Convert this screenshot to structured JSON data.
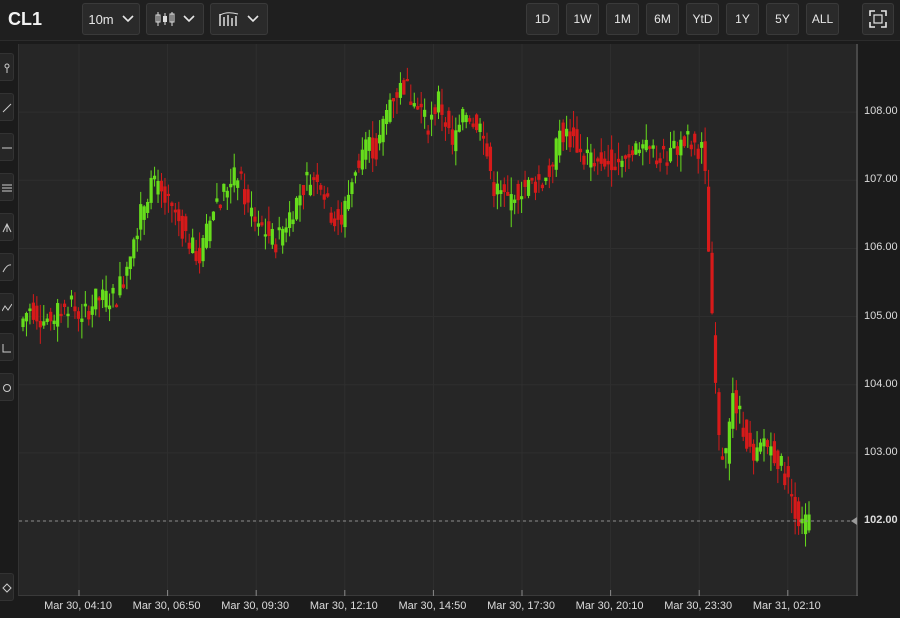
{
  "toolbar": {
    "ticker": "CL1",
    "interval": "10m",
    "chart_style_icon": "candlestick-icon",
    "indicators_icon": "indicators-icon",
    "ranges": [
      "1D",
      "1W",
      "1M",
      "6M",
      "YtD",
      "1Y",
      "5Y",
      "ALL"
    ],
    "fullscreen_icon": "fullscreen-icon"
  },
  "sidebar_tools": [
    "pin-icon",
    "trendline-icon",
    "horizontal-line-icon",
    "fibonacci-icon",
    "pitchfork-icon",
    "brush-icon",
    "pattern-icon",
    "measure-icon",
    "shapes-icon"
  ],
  "colors": {
    "up": "#66dd1c",
    "down": "#d61a1a",
    "background": "#262626"
  },
  "chart_data": {
    "type": "candlestick",
    "symbol": "CL1",
    "interval": "10m",
    "x_tick_labels": [
      "Mar 30, 04:10",
      "Mar 30, 06:50",
      "Mar 30, 09:30",
      "Mar 30, 12:10",
      "Mar 30, 14:50",
      "Mar 30, 17:30",
      "Mar 30, 20:10",
      "Mar 30, 23:30",
      "Mar 31, 02:10"
    ],
    "y_tick_labels": [
      "102.00",
      "103.00",
      "104.00",
      "105.00",
      "106.00",
      "107.00",
      "108.00"
    ],
    "ylim": [
      100.9,
      109.0
    ],
    "last_price": 102.0,
    "grid": true,
    "path_points": [
      [
        0,
        104.85
      ],
      [
        3,
        105.15
      ],
      [
        8,
        104.9
      ],
      [
        14,
        105.2
      ],
      [
        18,
        105.0
      ],
      [
        22,
        105.25
      ],
      [
        28,
        105.3
      ],
      [
        32,
        106.0
      ],
      [
        35,
        106.5
      ],
      [
        38,
        107.0
      ],
      [
        42,
        106.7
      ],
      [
        46,
        106.4
      ],
      [
        50,
        106.0
      ],
      [
        52,
        105.85
      ],
      [
        56,
        106.6
      ],
      [
        60,
        106.9
      ],
      [
        63,
        107.1
      ],
      [
        66,
        106.6
      ],
      [
        70,
        106.3
      ],
      [
        74,
        106.1
      ],
      [
        78,
        106.5
      ],
      [
        82,
        106.9
      ],
      [
        86,
        107.1
      ],
      [
        90,
        106.5
      ],
      [
        93,
        106.4
      ],
      [
        97,
        107.2
      ],
      [
        100,
        107.6
      ],
      [
        103,
        107.4
      ],
      [
        107,
        108.2
      ],
      [
        111,
        108.4
      ],
      [
        115,
        108.1
      ],
      [
        118,
        107.8
      ],
      [
        121,
        108.2
      ],
      [
        125,
        107.5
      ],
      [
        129,
        108.0
      ],
      [
        133,
        107.8
      ],
      [
        137,
        106.9
      ],
      [
        141,
        106.7
      ],
      [
        145,
        106.9
      ],
      [
        149,
        106.95
      ],
      [
        153,
        107.1
      ],
      [
        156,
        107.7
      ],
      [
        160,
        107.6
      ],
      [
        163,
        107.35
      ],
      [
        166,
        107.25
      ],
      [
        170,
        107.3
      ],
      [
        174,
        107.35
      ],
      [
        178,
        107.5
      ],
      [
        182,
        107.4
      ],
      [
        186,
        107.35
      ],
      [
        190,
        107.5
      ],
      [
        194,
        107.55
      ],
      [
        197,
        107.45
      ],
      [
        198,
        107.0
      ],
      [
        200,
        104.9
      ],
      [
        202,
        103.1
      ],
      [
        204,
        103.0
      ],
      [
        206,
        103.8
      ],
      [
        209,
        103.4
      ],
      [
        212,
        102.8
      ],
      [
        215,
        103.2
      ],
      [
        218,
        103.0
      ],
      [
        221,
        102.7
      ],
      [
        224,
        102.2
      ],
      [
        226,
        101.9
      ],
      [
        227,
        102.0
      ]
    ]
  }
}
